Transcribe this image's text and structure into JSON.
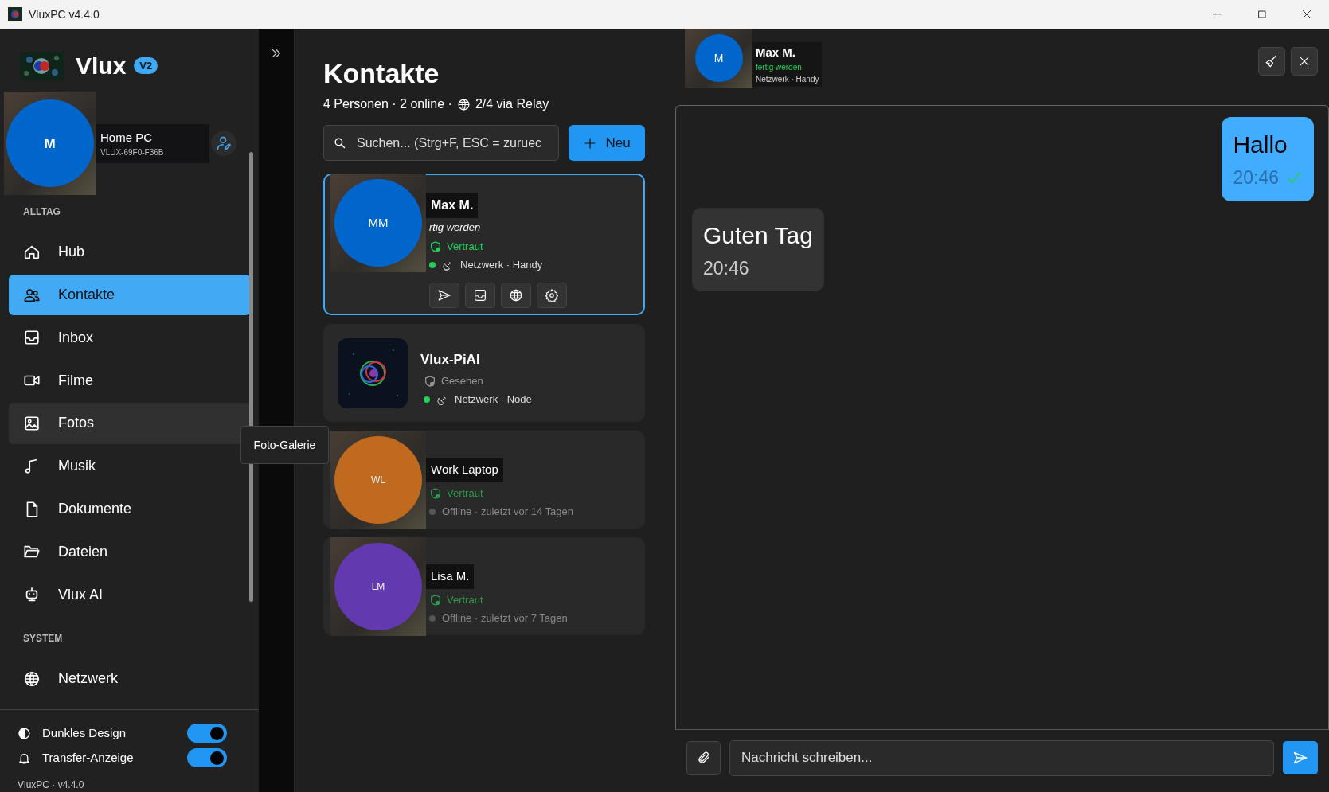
{
  "window": {
    "title": "VluxPC v4.4.0"
  },
  "brand": {
    "name": "Vlux",
    "badge": "V2"
  },
  "profile": {
    "initial": "M",
    "name": "Home PC",
    "id": "VLUX-69F0-F36B"
  },
  "sections": [
    {
      "heading": "ALLTAG",
      "items": [
        {
          "label": "Hub",
          "selected": false
        },
        {
          "label": "Kontakte",
          "selected": true
        },
        {
          "label": "Inbox",
          "selected": false
        },
        {
          "label": "Filme",
          "selected": false
        },
        {
          "label": "Fotos",
          "selected": false,
          "hovered": true
        },
        {
          "label": "Musik",
          "selected": false
        },
        {
          "label": "Dokumente",
          "selected": false
        },
        {
          "label": "Dateien",
          "selected": false
        },
        {
          "label": "Vlux AI",
          "selected": false
        }
      ]
    },
    {
      "heading": "SYSTEM",
      "items": [
        {
          "label": "Netzwerk",
          "selected": false
        }
      ]
    }
  ],
  "tooltip": "Foto-Galerie",
  "toggles": [
    {
      "label": "Dunkles Design",
      "on": true
    },
    {
      "label": "Transfer-Anzeige",
      "on": true
    }
  ],
  "footer": "VluxPC · v4.4.0",
  "contacts": {
    "title": "Kontakte",
    "summary": "4 Personen · 2 online ·",
    "relay": "2/4 via Relay",
    "search": {
      "placeholder": "Suchen... (Strg+F, ESC = zuruec"
    },
    "new_button": "Neu",
    "items": [
      {
        "kind": "initials",
        "name": "Max M.",
        "initials": "MM",
        "color": "#0066cc",
        "status": "rtig werden",
        "trust": "Vertraut",
        "trusted": true,
        "online": true,
        "presence": "Netzwerk · Handy",
        "selected": true
      },
      {
        "kind": "picture",
        "name": "Vlux-PiAI",
        "trust": "Gesehen",
        "trusted": false,
        "online": true,
        "presence": "Netzwerk · Node",
        "selected": false
      },
      {
        "kind": "initials",
        "name": "Work Laptop",
        "initials": "WL",
        "color": "#c86e1e",
        "trust": "Vertraut",
        "trusted": true,
        "online": false,
        "presence": "Offline · zuletzt vor 14 Tagen",
        "selected": false
      },
      {
        "kind": "initials",
        "name": "Lisa M.",
        "initials": "LM",
        "color": "#673ab7",
        "trust": "Vertraut",
        "trusted": true,
        "online": false,
        "presence": "Offline · zuletzt vor 7 Tagen",
        "selected": false
      }
    ]
  },
  "chat": {
    "initial": "M",
    "name": "Max M.",
    "status": "fertig werden",
    "presence": "Netzwerk · Handy",
    "messages": [
      {
        "text": "Hallo",
        "time": "20:46",
        "outgoing": true,
        "delivered": true
      },
      {
        "text": "Guten Tag",
        "time": "20:46",
        "outgoing": false,
        "delivered": false
      }
    ],
    "input": {
      "placeholder": "Nachricht schreiben..."
    }
  }
}
